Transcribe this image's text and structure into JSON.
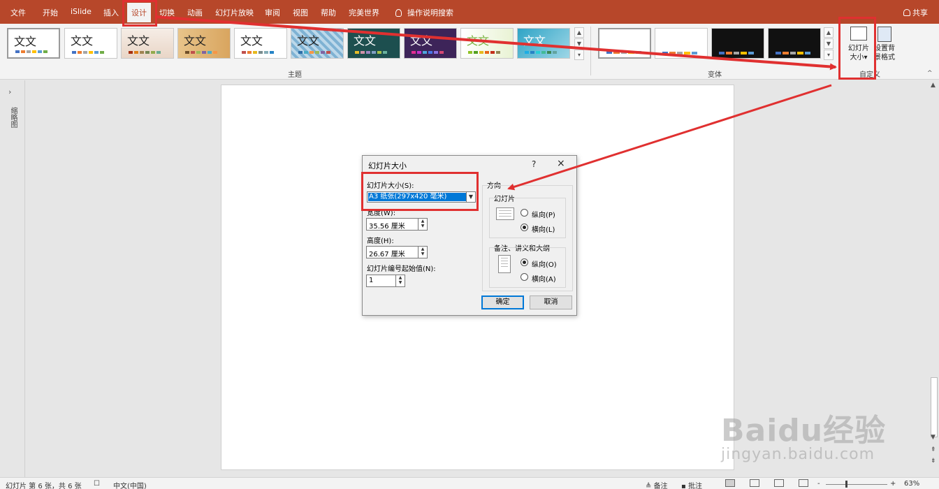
{
  "menu": {
    "items": [
      "文件",
      "开始",
      "iSlide",
      "插入",
      "设计",
      "切换",
      "动画",
      "幻灯片放映",
      "审阅",
      "视图",
      "帮助",
      "完美世界"
    ],
    "active": "设计",
    "search": "操作说明搜索",
    "share": "共享"
  },
  "ribbon": {
    "theme_sample_text": "文文",
    "themes_group_label": "主题",
    "variants_group_label": "变体",
    "custom_group_label": "自定义",
    "slide_size_label_1": "幻灯片",
    "slide_size_label_2": "大小",
    "format_bg_label_1": "设置背",
    "format_bg_label_2": "景格式",
    "colors": {
      "brand": "#b7472a",
      "ribbon_bg": "#f3f3f3",
      "annotation": "#e03030"
    }
  },
  "left_panel": {
    "label": "缩略图"
  },
  "dialog": {
    "title": "幻灯片大小",
    "help": "?",
    "close": "×",
    "size_label": "幻灯片大小(S):",
    "size_value": "A3 纸张(297x420 毫米)",
    "width_label": "宽度(W):",
    "width_value": "35.56 厘米",
    "height_label": "高度(H):",
    "height_value": "26.67 厘米",
    "start_label": "幻灯片编号起始值(N):",
    "start_value": "1",
    "orientation_label": "方向",
    "slides_group": "幻灯片",
    "slides_portrait": "纵向(P)",
    "slides_landscape": "横向(L)",
    "notes_group": "备注、讲义和大纲",
    "notes_portrait": "纵向(O)",
    "notes_landscape": "横向(A)",
    "ok": "确定",
    "cancel": "取消"
  },
  "status": {
    "slide_info": "幻灯片 第 6 张，共 6 张",
    "language": "中文(中国)",
    "notes": "备注",
    "comments": "批注",
    "zoom_minus": "-",
    "zoom_plus": "+",
    "zoom": "63%"
  },
  "watermark": {
    "line1": "Baidu经验",
    "line2": "jingyan.baidu.com"
  }
}
